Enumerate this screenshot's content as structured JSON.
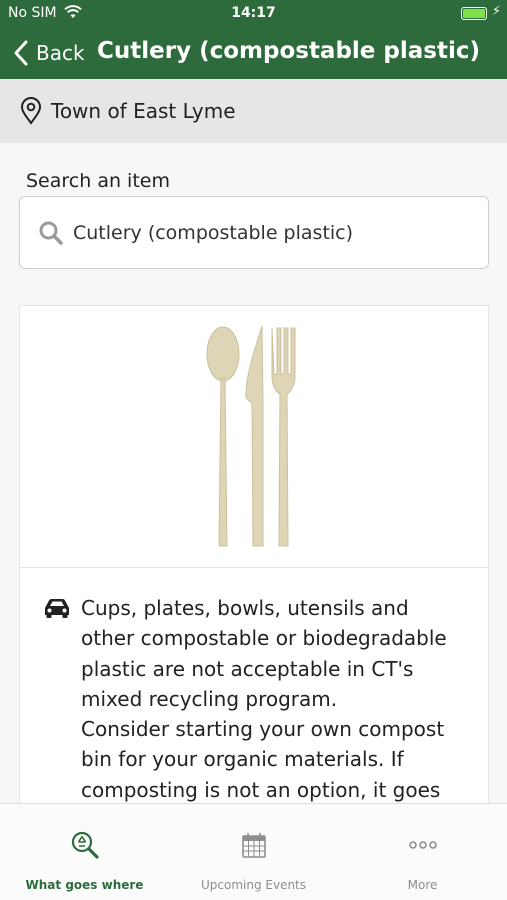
{
  "status_bar": {
    "carrier": "No SIM",
    "time": "14:17"
  },
  "nav": {
    "back_label": "Back",
    "title": "Cutlery (compostable plastic)"
  },
  "location": {
    "label": "Town of East Lyme"
  },
  "search": {
    "label": "Search an item",
    "value": "Cutlery (compostable plastic)"
  },
  "item": {
    "description_lines": [
      "Cups, plates, bowls, utensils and",
      "other compostable or biodegradable",
      "plastic are not acceptable in CT's",
      "mixed recycling program.",
      "Consider starting your own compost",
      "bin for your organic materials. If",
      "composting is not an option, it goes"
    ]
  },
  "tabs": [
    {
      "label": "What goes where",
      "icon": "recycle-search-icon",
      "active": true
    },
    {
      "label": "Upcoming Events",
      "icon": "calendar-icon",
      "active": false
    },
    {
      "label": "More",
      "icon": "more-dots-icon",
      "active": false
    }
  ],
  "colors": {
    "brand_green": "#2e6b3c",
    "battery_green": "#7ee04a",
    "tab_inactive": "#8e8e8e"
  }
}
